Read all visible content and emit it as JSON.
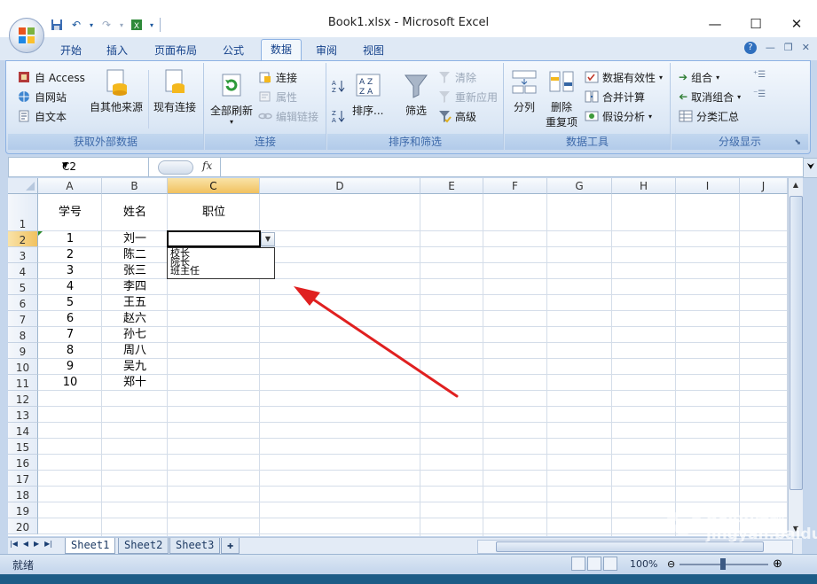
{
  "window": {
    "title": "Book1.xlsx - Microsoft Excel",
    "minimize": "—",
    "maximize": "☐",
    "close": "✕"
  },
  "tabs": [
    "开始",
    "插入",
    "页面布局",
    "公式",
    "数据",
    "审阅",
    "视图"
  ],
  "active_tab": "数据",
  "ribbon": {
    "get_external": {
      "label": "获取外部数据",
      "access": "自 Access",
      "web": "自网站",
      "text": "自文本",
      "other": "自其他来源",
      "existing": "现有连接"
    },
    "connections": {
      "label": "连接",
      "refresh_all": "全部刷新",
      "connections": "连接",
      "properties": "属性",
      "edit_links": "编辑链接"
    },
    "sort_filter": {
      "label": "排序和筛选",
      "sort": "排序...",
      "filter": "筛选",
      "clear": "清除",
      "reapply": "重新应用",
      "advanced": "高级"
    },
    "data_tools": {
      "label": "数据工具",
      "text_to_columns": "分列",
      "remove_dup_1": "删除",
      "remove_dup_2": "重复项",
      "validation": "数据有效性",
      "consolidate": "合并计算",
      "what_if": "假设分析"
    },
    "outline": {
      "label": "分级显示",
      "group": "组合",
      "ungroup": "取消组合",
      "subtotal": "分类汇总"
    }
  },
  "formula_bar": {
    "name_box": "C2",
    "fx": "fx",
    "value": ""
  },
  "columns": [
    "A",
    "B",
    "C",
    "D",
    "E",
    "F",
    "G",
    "H",
    "I",
    "J"
  ],
  "rows": [
    "1",
    "2",
    "3",
    "4",
    "5",
    "6",
    "7",
    "8",
    "9",
    "10",
    "11",
    "12",
    "13",
    "14",
    "15",
    "16",
    "17",
    "18",
    "19",
    "20"
  ],
  "selected_cell": "C2",
  "headers": {
    "a1": "学号",
    "b1": "姓名",
    "c1": "职位"
  },
  "students": [
    {
      "id": "1",
      "name": "刘一"
    },
    {
      "id": "2",
      "name": "陈二"
    },
    {
      "id": "3",
      "name": "张三"
    },
    {
      "id": "4",
      "name": "李四"
    },
    {
      "id": "5",
      "name": "王五"
    },
    {
      "id": "6",
      "name": "赵六"
    },
    {
      "id": "7",
      "name": "孙七"
    },
    {
      "id": "8",
      "name": "周八"
    },
    {
      "id": "9",
      "name": "吴九"
    },
    {
      "id": "10",
      "name": "郑十"
    }
  ],
  "dropdown_options": [
    "校长",
    "院长",
    "班主任"
  ],
  "sheets": [
    "Sheet1",
    "Sheet2",
    "Sheet3"
  ],
  "active_sheet": "Sheet1",
  "status": {
    "ready": "就绪",
    "zoom": "100%"
  },
  "watermark": "Baidu经验 jingyan.baidu.com",
  "colors": {
    "arrow": "#e02020",
    "selection_header": "#f1c15f",
    "ribbon_label": "#3e6aaa"
  }
}
